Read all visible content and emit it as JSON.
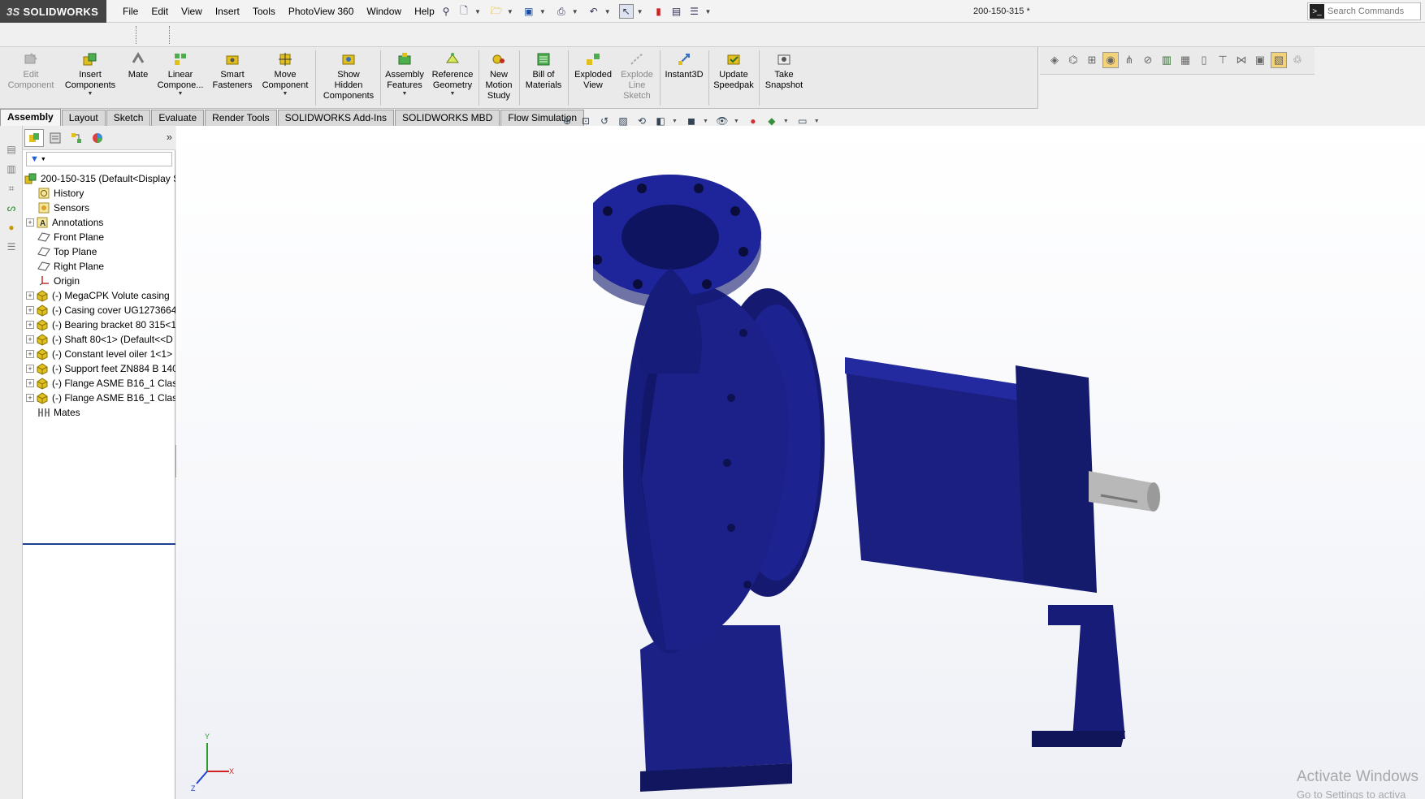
{
  "app": {
    "brand": "SOLIDWORKS",
    "brand_prefix": "3S",
    "document_title": "200-150-315 *"
  },
  "menu": [
    "File",
    "Edit",
    "View",
    "Insert",
    "Tools",
    "PhotoView 360",
    "Window",
    "Help"
  ],
  "search": {
    "placeholder": "Search Commands"
  },
  "commands": [
    {
      "label": "Edit\nComponent",
      "icon": "edit-component-icon"
    },
    {
      "label": "Insert\nComponents",
      "icon": "insert-components-icon"
    },
    {
      "label": "Mate",
      "icon": "mate-icon"
    },
    {
      "label": "Linear\nCompone...",
      "icon": "linear-pattern-icon"
    },
    {
      "label": "Smart\nFasteners",
      "icon": "smart-fasteners-icon"
    },
    {
      "label": "Move\nComponent",
      "icon": "move-component-icon"
    },
    {
      "label": "Show\nHidden\nComponents",
      "icon": "show-hidden-icon"
    },
    {
      "label": "Assembly\nFeatures",
      "icon": "assembly-features-icon"
    },
    {
      "label": "Reference\nGeometry",
      "icon": "reference-geometry-icon"
    },
    {
      "label": "New\nMotion\nStudy",
      "icon": "motion-study-icon"
    },
    {
      "label": "Bill of\nMaterials",
      "icon": "bom-icon"
    },
    {
      "label": "Exploded\nView",
      "icon": "exploded-view-icon"
    },
    {
      "label": "Explode\nLine\nSketch",
      "icon": "explode-line-icon"
    },
    {
      "label": "Instant3D",
      "icon": "instant3d-icon"
    },
    {
      "label": "Update\nSpeedpak",
      "icon": "speedpak-icon"
    },
    {
      "label": "Take\nSnapshot",
      "icon": "snapshot-icon"
    }
  ],
  "tabs": [
    "Assembly",
    "Layout",
    "Sketch",
    "Evaluate",
    "Render Tools",
    "SOLIDWORKS Add-Ins",
    "SOLIDWORKS MBD",
    "Flow Simulation"
  ],
  "tree": {
    "root": "200-150-315  (Default<Display S",
    "items": [
      {
        "label": "History",
        "icon": "history-icon"
      },
      {
        "label": "Sensors",
        "icon": "sensors-icon"
      },
      {
        "label": "Annotations",
        "icon": "annotations-icon"
      },
      {
        "label": "Front Plane",
        "icon": "plane-icon"
      },
      {
        "label": "Top Plane",
        "icon": "plane-icon"
      },
      {
        "label": "Right Plane",
        "icon": "plane-icon"
      },
      {
        "label": "Origin",
        "icon": "origin-icon"
      },
      {
        "label": "(-) MegaCPK Volute casing",
        "icon": "part-icon"
      },
      {
        "label": "(-) Casing cover UG1273664",
        "icon": "part-icon"
      },
      {
        "label": "(-) Bearing bracket 80 315<1",
        "icon": "part-icon"
      },
      {
        "label": "(-) Shaft 80<1> (Default<<D",
        "icon": "part-icon"
      },
      {
        "label": "(-) Constant level oiler 1<1>",
        "icon": "part-icon"
      },
      {
        "label": "(-) Support feet ZN884 B 140",
        "icon": "part-icon"
      },
      {
        "label": "(-) Flange ASME B16_1 Class",
        "icon": "part-icon"
      },
      {
        "label": "(-) Flange ASME B16_1 Class",
        "icon": "part-icon"
      },
      {
        "label": "Mates",
        "icon": "mates-icon"
      }
    ]
  },
  "triad": {
    "x": "X",
    "y": "Y",
    "z": "Z"
  },
  "watermark": {
    "line1": "Activate Windows",
    "line2": "Go to Settings to activa"
  },
  "colors": {
    "model": "#1a1f7a",
    "model_dark": "#0d1050",
    "shaft": "#b8b8b8",
    "tree_select": "#1f3f8f"
  }
}
